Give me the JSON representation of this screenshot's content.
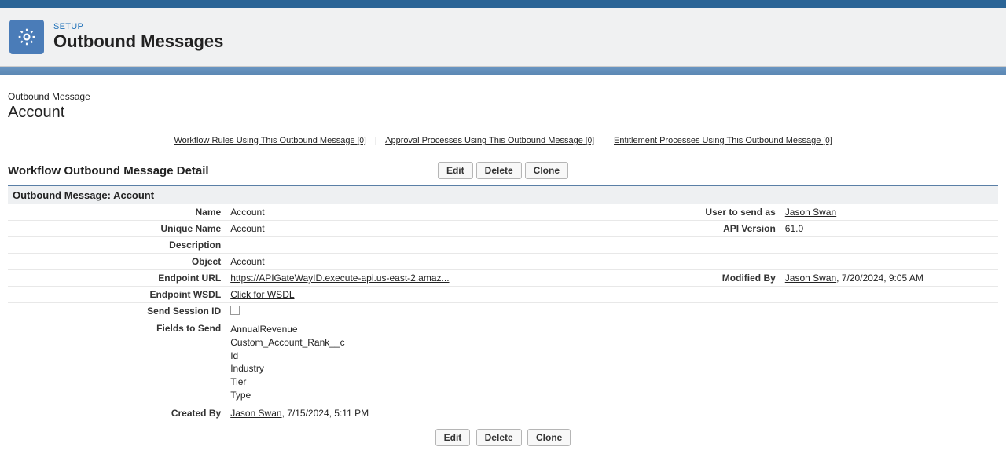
{
  "header": {
    "setup_label": "SETUP",
    "page_title": "Outbound Messages"
  },
  "breadcrumb": {
    "type": "Outbound Message",
    "name": "Account"
  },
  "related": {
    "workflow": {
      "label": "Workflow Rules Using This Outbound Message",
      "count": "[0]"
    },
    "approval": {
      "label": "Approval Processes Using This Outbound Message",
      "count": "[0]"
    },
    "entitlement": {
      "label": "Entitlement Processes Using This Outbound Message",
      "count": "[0]"
    }
  },
  "section": {
    "title": "Workflow Outbound Message Detail",
    "bar": "Outbound Message: Account"
  },
  "buttons": {
    "edit": "Edit",
    "delete": "Delete",
    "clone": "Clone"
  },
  "labels": {
    "name": "Name",
    "unique_name": "Unique Name",
    "description": "Description",
    "object": "Object",
    "endpoint_url": "Endpoint URL",
    "endpoint_wsdl": "Endpoint WSDL",
    "send_session_id": "Send Session ID",
    "fields_to_send": "Fields to Send",
    "created_by": "Created By",
    "user_to_send_as": "User to send as",
    "api_version": "API Version",
    "modified_by": "Modified By"
  },
  "values": {
    "name": "Account",
    "unique_name": "Account",
    "description": "",
    "object": "Account",
    "endpoint_url": "https://APIGateWayID.execute-api.us-east-2.amaz...",
    "endpoint_wsdl": "Click for WSDL",
    "api_version": "61.0",
    "user_to_send_as": "Jason Swan",
    "created_by_user": "Jason Swan",
    "created_by_rest": ", 7/15/2024, 5:11 PM",
    "modified_by_user": "Jason Swan",
    "modified_by_rest": ", 7/20/2024, 9:05 AM",
    "fields": {
      "f0": "AnnualRevenue",
      "f1": "Custom_Account_Rank__c",
      "f2": "Id",
      "f3": "Industry",
      "f4": "Tier",
      "f5": "Type"
    }
  }
}
